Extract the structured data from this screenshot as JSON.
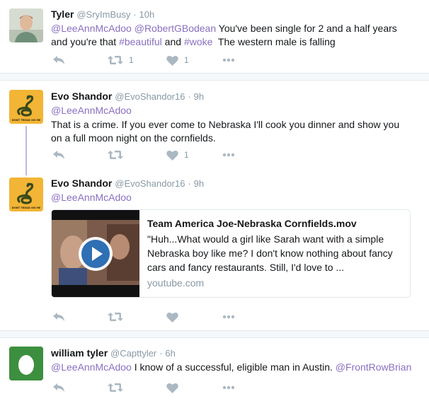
{
  "colors": {
    "link": "#8a6fbf",
    "muted": "#8899a6",
    "thread": "#c5b7e2",
    "divider": "#f5f8fa"
  },
  "tweets": [
    {
      "name": "Tyler",
      "handle": "@SryImBusy",
      "dot": "·",
      "time": "10h",
      "mention1": "@LeeAnnMcAdoo",
      "mention2": "@RobertGBodean",
      "text1": " You've been single for 2 and a half years and you're that ",
      "tag1": "#beautiful",
      "text2": " and ",
      "tag2": "#woke",
      "text3": "  The western male is falling",
      "retweet_count": "1",
      "like_count": "1"
    },
    {
      "name": "Evo Shandor",
      "handle": "@EvoShandor16",
      "dot": "·",
      "time": "9h",
      "mention": "@LeeAnnMcAdoo",
      "text": "That is a crime. If you ever come to Nebraska I'll cook you dinner and show you on a full moon night on the cornfields.",
      "like_count": "1"
    },
    {
      "name": "Evo Shandor",
      "handle": "@EvoShandor16",
      "dot": "·",
      "time": "9h",
      "mention": "@LeeAnnMcAdoo",
      "card": {
        "title": "Team America Joe-Nebraska Cornfields.mov",
        "description": "\"Huh...What would a girl like Sarah want with a simple Nebraska boy like me? I don't know nothing about fancy cars and fancy restaurants. Still, I'd love to ...",
        "domain": "youtube.com",
        "thumb_icon": "play-icon"
      }
    },
    {
      "name": "william tyler",
      "handle": "@Capttyler",
      "dot": "·",
      "time": "6h",
      "mention": "@LeeAnnMcAdoo",
      "text": " I know of a successful, eligible man in Austin. ",
      "mention2": "@FrontRowBrian"
    }
  ],
  "avatar_text": "DONT TREAD ON ME"
}
